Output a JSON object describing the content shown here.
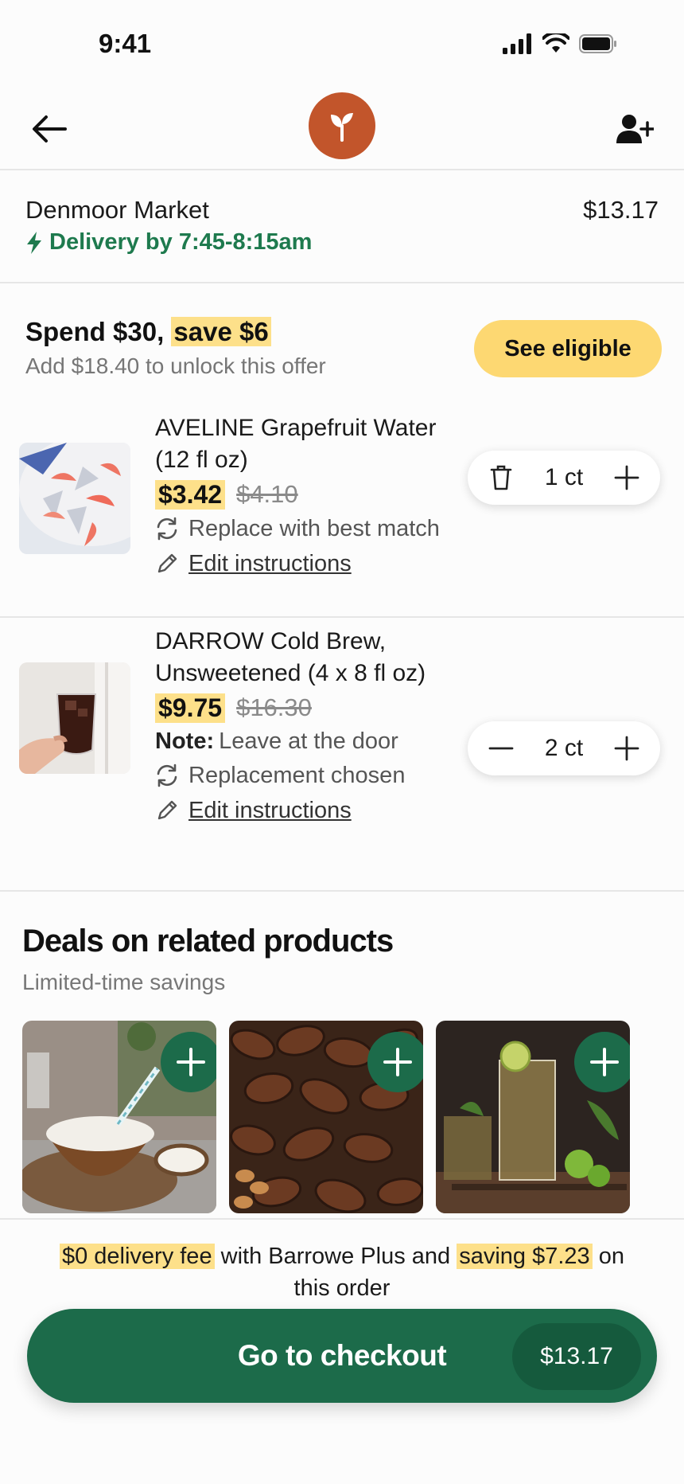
{
  "status_bar": {
    "time": "9:41"
  },
  "nav": {
    "back": "back-arrow-icon",
    "logo": "sprout-icon",
    "add_person": "add-person-icon"
  },
  "store": {
    "name": "Denmoor Market",
    "total": "$13.17",
    "delivery": "Delivery by 7:45-8:15am"
  },
  "offer": {
    "title_prefix": "Spend $30,",
    "title_highlight": "save $6",
    "subtitle": "Add $18.40 to unlock this offer",
    "button_label": "See eligible"
  },
  "items": [
    {
      "name": "AVELINE Grapefruit Water (12 fl oz)",
      "price": "$3.42",
      "original_price": "$4.10",
      "replacement": "Replace with best match",
      "edit": "Edit instructions",
      "quantity": "1 ct"
    },
    {
      "name": "DARROW Cold Brew, Unsweetened (4 x 8 fl oz)",
      "price": "$9.75",
      "original_price": "$16.30",
      "note_label": "Note:",
      "note": "Leave at the door",
      "replacement": "Replacement chosen",
      "edit": "Edit instructions",
      "quantity": "2 ct"
    }
  ],
  "deals": {
    "title": "Deals on related products",
    "subtitle": "Limited-time savings",
    "products": [
      "coconut drink",
      "dates",
      "iced tea with lime"
    ]
  },
  "bottom": {
    "promo_1": "$0 delivery fee",
    "promo_2": " with Barrowe Plus and ",
    "promo_3": "saving $7.23",
    "promo_4": " on this order",
    "checkout_label": "Go to checkout",
    "checkout_total": "$13.17"
  },
  "colors": {
    "brand_green": "#1c6b4a",
    "highlight": "#fde08a",
    "logo": "#c2552b",
    "delivery": "#1e7a4e"
  }
}
